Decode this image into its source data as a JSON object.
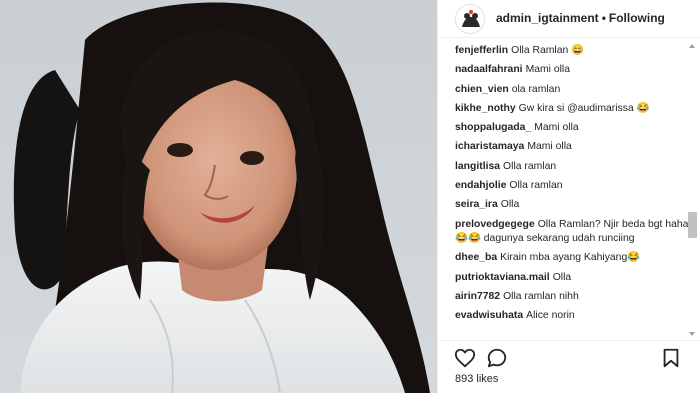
{
  "header": {
    "username": "admin_igtainment",
    "separator": "•",
    "follow_status": "Following"
  },
  "comments": [
    {
      "user": "fenjefferlin",
      "text": "Olla Ramlan 😄"
    },
    {
      "user": "nadaalfahrani",
      "text": "Mami olla"
    },
    {
      "user": "chien_vien",
      "text": "ola ramlan"
    },
    {
      "user": "kikhe_nothy",
      "text": "Gw kira si @audimarissa 😂"
    },
    {
      "user": "shoppalugada_",
      "text": "Mami olla"
    },
    {
      "user": "icharistamaya",
      "text": "Mami olla"
    },
    {
      "user": "langitlisa",
      "text": "Olla ramlan"
    },
    {
      "user": "endahjolie",
      "text": "Olla ramlan"
    },
    {
      "user": "seira_ira",
      "text": "Olla"
    },
    {
      "user": "prelovedgegege",
      "text": "Olla Ramlan? Njir beda bgt haha 😂😂 dagunya sekarang udah runciing"
    },
    {
      "user": "dhee_ba",
      "text": "Kirain mba ayang Kahiyang😂"
    },
    {
      "user": "putrioktaviana.mail",
      "text": "Olla"
    },
    {
      "user": "airin7782",
      "text": "Olla ramlan nihh"
    },
    {
      "user": "evadwisuhata",
      "text": "Alice norin"
    }
  ],
  "actions": {
    "like_icon": "heart-outline-icon",
    "comment_icon": "speech-bubble-icon",
    "save_icon": "bookmark-icon"
  },
  "likes": "893 likes",
  "colors": {
    "text": "#262626",
    "border": "#efefef",
    "scroll_thumb": "#c1c1c1"
  }
}
